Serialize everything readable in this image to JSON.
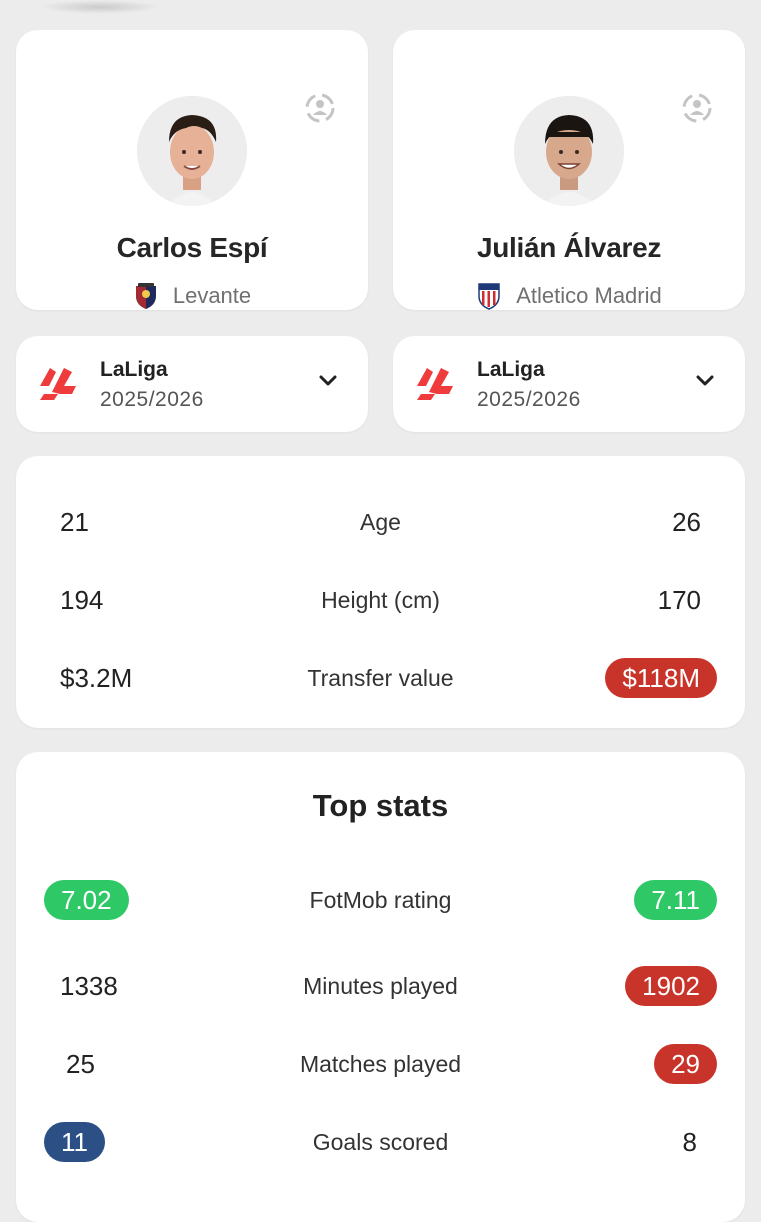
{
  "colors": {
    "background": "#ececec",
    "card": "#ffffff",
    "green": "#2ec866",
    "red": "#c8342a",
    "blue": "#2c4f86"
  },
  "players": [
    {
      "name": "Carlos Espí",
      "club": "Levante",
      "swap_icon": "swap-player-icon",
      "club_icon": "levante-crest-icon"
    },
    {
      "name": "Julián Álvarez",
      "club": "Atletico Madrid",
      "swap_icon": "swap-player-icon",
      "club_icon": "atletico-madrid-crest-icon"
    }
  ],
  "leagues": [
    {
      "name": "LaLiga",
      "season": "2025/2026",
      "icon": "laliga-logo-icon"
    },
    {
      "name": "LaLiga",
      "season": "2025/2026",
      "icon": "laliga-logo-icon"
    }
  ],
  "bio": [
    {
      "label": "Age",
      "left": "21",
      "right": "26"
    },
    {
      "label": "Height (cm)",
      "left": "194",
      "right": "170"
    },
    {
      "label": "Transfer value",
      "left": "$3.2M",
      "right": "$118M",
      "right_highlight": "red"
    }
  ],
  "top_stats": {
    "title": "Top stats",
    "rows": [
      {
        "label": "FotMob rating",
        "left": "7.02",
        "right": "7.11",
        "left_highlight": "green",
        "right_highlight": "green"
      },
      {
        "label": "Minutes played",
        "left": "1338",
        "right": "1902",
        "right_highlight": "red"
      },
      {
        "label": "Matches played",
        "left": "25",
        "right": "29",
        "right_highlight": "red"
      },
      {
        "label": "Goals scored",
        "left": "11",
        "right": "8",
        "left_highlight": "blue"
      }
    ]
  }
}
